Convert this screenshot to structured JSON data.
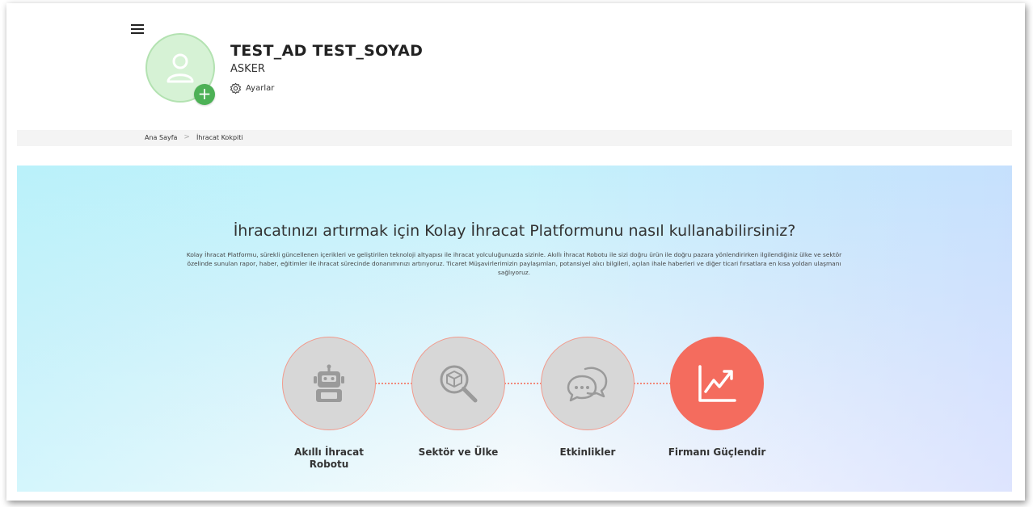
{
  "user": {
    "name": "TEST_AD TEST_SOYAD",
    "role": "ASKER",
    "settings_label": "Ayarlar",
    "add_label": "+"
  },
  "breadcrumb": [
    {
      "label": "Ana Sayfa"
    },
    {
      "label": "İhracat Kokpiti"
    }
  ],
  "breadcrumb_separator": ">",
  "hero": {
    "title": "İhracatınızı artırmak için Kolay İhracat Platformunu nasıl kullanabilirsiniz?",
    "description": "Kolay İhracat Platformu, sürekli güncellenen içerikleri ve geliştirilen teknoloji altyapısı ile ihracat yolculuğunuzda sizinle. Akıllı İhracat Robotu ile sizi doğru ürün ile doğru pazara yönlendirirken ilgilendiğiniz ülke ve sektör özelinde sunulan rapor, haber, eğitimler ile ihracat sürecinde donanımınızı artırıyoruz. Ticaret Müşavirlerimizin paylaşımları, potansiyel alıcı bilgileri, açılan ihale haberleri ve diğer ticari fırsatlara en kısa yoldan ulaşmanı sağlıyoruz."
  },
  "steps": [
    {
      "label": "Akıllı İhracat Robotu",
      "icon": "robot-icon",
      "active": false
    },
    {
      "label": "Sektör ve Ülke",
      "icon": "search-box-icon",
      "active": false
    },
    {
      "label": "Etkinlikler",
      "icon": "chat-bubbles-icon",
      "active": false
    },
    {
      "label": "Firmanı Güçlendir",
      "icon": "growth-chart-icon",
      "active": true
    }
  ],
  "colors": {
    "accent": "#f46c5e",
    "avatar_bg": "#d6f2d5",
    "add_button": "#4db156",
    "inactive_circle": "#d7d7d7"
  }
}
